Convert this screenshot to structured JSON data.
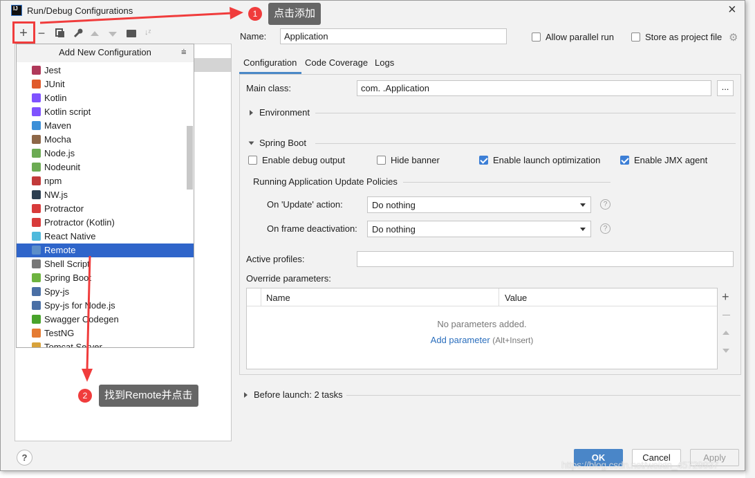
{
  "window": {
    "title": "Run/Debug Configurations",
    "close": "×"
  },
  "toolbar": {
    "add": "+",
    "remove": "−"
  },
  "popup": {
    "title": "Add New Configuration",
    "items": [
      {
        "label": "Jest",
        "color": "#b0395a"
      },
      {
        "label": "JUnit",
        "color": "#e05a2b"
      },
      {
        "label": "Kotlin",
        "color": "#7f52ff"
      },
      {
        "label": "Kotlin script",
        "color": "#7f52ff"
      },
      {
        "label": "Maven",
        "color": "#3c8fd8"
      },
      {
        "label": "Mocha",
        "color": "#8d6748"
      },
      {
        "label": "Node.js",
        "color": "#6cab53"
      },
      {
        "label": "Nodeunit",
        "color": "#6cab53"
      },
      {
        "label": "npm",
        "color": "#c23a3a"
      },
      {
        "label": "NW.js",
        "color": "#2c3e50"
      },
      {
        "label": "Protractor",
        "color": "#d83b3b"
      },
      {
        "label": "Protractor (Kotlin)",
        "color": "#d83b3b"
      },
      {
        "label": "React Native",
        "color": "#4fb9dc"
      },
      {
        "label": "Remote",
        "color": "#5b8ec9",
        "selected": true
      },
      {
        "label": "Shell Script",
        "color": "#777777"
      },
      {
        "label": "Spring Boot",
        "color": "#6db33f"
      },
      {
        "label": "Spy-js",
        "color": "#4a6fa5"
      },
      {
        "label": "Spy-js for Node.js",
        "color": "#4a6fa5"
      },
      {
        "label": "Swagger Codegen",
        "color": "#49a32b"
      },
      {
        "label": "TestNG",
        "color": "#e57b32"
      },
      {
        "label": "Tomcat Server",
        "color": "#d8a23a"
      }
    ]
  },
  "form": {
    "name_label": "Name:",
    "name_value": "Application",
    "allow_parallel": "Allow parallel run",
    "store_project": "Store as project file",
    "tabs": [
      "Configuration",
      "Code Coverage",
      "Logs"
    ],
    "main_class_label": "Main class:",
    "main_class_value": "com.      .Application",
    "browse": "...",
    "environment": "Environment",
    "spring_boot": "Spring Boot",
    "checks": [
      {
        "label": "Enable debug output",
        "checked": false
      },
      {
        "label": "Hide banner",
        "checked": false
      },
      {
        "label": "Enable launch optimization",
        "checked": true
      },
      {
        "label": "Enable JMX agent",
        "checked": true
      }
    ],
    "policies_title": "Running Application Update Policies",
    "update_label": "On 'Update' action:",
    "update_value": "Do nothing",
    "frame_label": "On frame deactivation:",
    "frame_value": "Do nothing",
    "active_profiles_label": "Active profiles:",
    "override_label": "Override parameters:",
    "table": {
      "columns": [
        "Name",
        "Value"
      ],
      "empty": "No parameters added.",
      "add_link": "Add parameter",
      "add_hint": "(Alt+Insert)"
    },
    "before_launch": "Before launch: 2 tasks"
  },
  "buttons": {
    "ok": "OK",
    "cancel": "Cancel",
    "apply": "Apply",
    "help": "?"
  },
  "annotations": {
    "step1_num": "1",
    "step1_text": "点击添加",
    "step2_num": "2",
    "step2_text": "找到Remote并点击",
    "color": "#f03c3c"
  },
  "watermark": "https://blog.csdn.net/weixin_45729937"
}
